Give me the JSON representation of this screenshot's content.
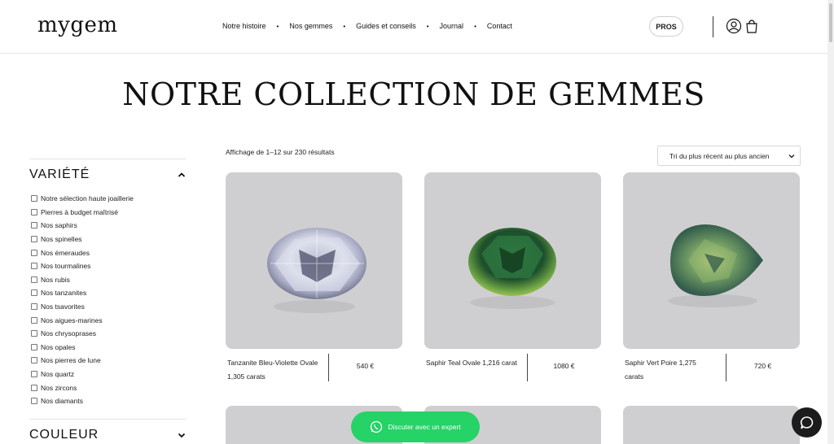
{
  "header": {
    "logo": "mygem",
    "nav": [
      "Notre histoire",
      "Nos gemmes",
      "Guides et conseils",
      "Journal",
      "Contact"
    ],
    "pros_label": "PROS"
  },
  "page_title": "NOTRE COLLECTION DE GEMMES",
  "sidebar": {
    "variety_title": "VARIÉTÉ",
    "variety_options": [
      "Notre sélection haute joaillerie",
      "Pierres à budget maîtrisé",
      "Nos saphirs",
      "Nos spinelles",
      "Nos émeraudes",
      "Nos tourmalines",
      "Nos rubis",
      "Nos tanzanites",
      "Nos tsavorites",
      "Nos aigues-marines",
      "Nos chrysoprases",
      "Nos opales",
      "Nos pierres de lune",
      "Nos quartz",
      "Nos zircons",
      "Nos diamants"
    ],
    "color_title": "COULEUR"
  },
  "results": {
    "count_text": "Affichage de 1–12 sur 230 résultats",
    "sort_label": "Tri du plus récent au plus ancien"
  },
  "products": [
    {
      "name": "Tanzanite Bleu-Violette Ovale 1,305 carats",
      "price": "540 €"
    },
    {
      "name": "Saphir Teal Ovale 1,216 carat",
      "price": "1080 €"
    },
    {
      "name": "Saphir Vert Poire 1,275 carats",
      "price": "720 €"
    }
  ],
  "whatsapp_label": "Discuter avec un expert",
  "colors": {
    "whatsapp": "#25d366",
    "card_bg": "#cfcfd1",
    "chat_button": "#1c1c1c"
  }
}
